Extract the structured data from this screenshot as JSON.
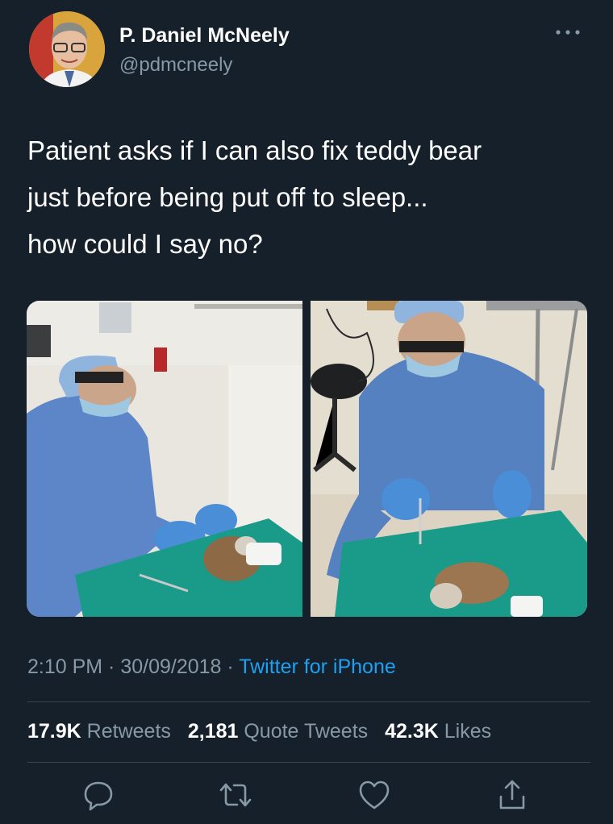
{
  "author": {
    "name": "P. Daniel McNeely",
    "handle": "@pdmcneely",
    "avatar_icon": "profile-photo"
  },
  "more_icon": "more-horizontal-icon",
  "tweet": {
    "lines": [
      "Patient asks if I can also fix teddy bear",
      "just before being put off to sleep...",
      "how could I say no?"
    ],
    "media": [
      {
        "icon": "photo-surgeon-bear-1"
      },
      {
        "icon": "photo-surgeon-bear-2"
      }
    ]
  },
  "meta": {
    "time": "2:10 PM",
    "sep1": " · ",
    "date": "30/09/2018",
    "sep2": " · ",
    "source": "Twitter for iPhone"
  },
  "stats": {
    "retweets_count": "17.9K",
    "retweets_label": "Retweets",
    "quotes_count": "2,181",
    "quotes_label": "Quote Tweets",
    "likes_count": "42.3K",
    "likes_label": "Likes"
  },
  "actions": [
    "reply-icon",
    "retweet-icon",
    "like-icon",
    "share-icon"
  ],
  "colors": {
    "background": "#15202b",
    "text": "#ffffff",
    "secondary": "#8899a6",
    "link": "#1da1f2",
    "divider": "#38444d"
  }
}
